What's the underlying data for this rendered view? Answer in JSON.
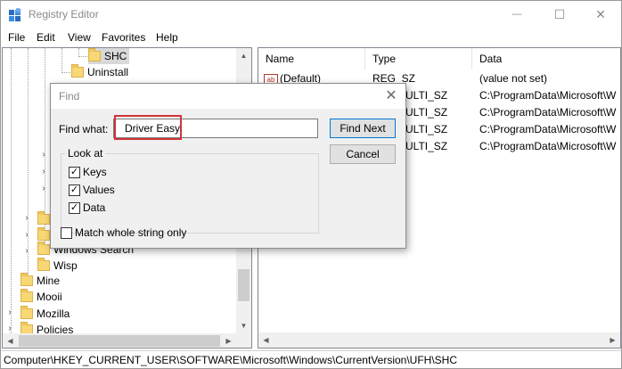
{
  "window": {
    "title": "Registry Editor",
    "minimize_glyph": "—",
    "maximize_glyph": "☐",
    "close_glyph": "✕"
  },
  "menu": [
    "File",
    "Edit",
    "View",
    "Favorites",
    "Help"
  ],
  "tree": {
    "top_items": [
      {
        "label": "SHC"
      },
      {
        "label": "Uninstall"
      }
    ],
    "hidden_under_dialog": [
      {
        "label": "Windows Search"
      },
      {
        "label": "Wisp"
      }
    ],
    "root_items": [
      {
        "label": "Mine"
      },
      {
        "label": "Mooii"
      },
      {
        "label": "Mozilla"
      },
      {
        "label": "Policies"
      }
    ]
  },
  "list": {
    "columns": [
      "Name",
      "Type",
      "Data"
    ],
    "rows": [
      {
        "name": "(Default)",
        "type": "REG_SZ",
        "data": "(value not set)"
      },
      {
        "name": "",
        "type": "ULTI_SZ",
        "data": "C:\\ProgramData\\Microsoft\\W"
      },
      {
        "name": "",
        "type": "ULTI_SZ",
        "data": "C:\\ProgramData\\Microsoft\\W"
      },
      {
        "name": "",
        "type": "ULTI_SZ",
        "data": "C:\\ProgramData\\Microsoft\\W"
      },
      {
        "name": "",
        "type": "ULTI_SZ",
        "data": "C:\\ProgramData\\Microsoft\\W"
      }
    ]
  },
  "status": {
    "path": "Computer\\HKEY_CURRENT_USER\\SOFTWARE\\Microsoft\\Windows\\CurrentVersion\\UFH\\SHC"
  },
  "find_dialog": {
    "title": "Find",
    "find_what_label": "Find what:",
    "find_what_value": "Driver Easy",
    "find_next_label": "Find Next",
    "cancel_label": "Cancel",
    "look_at_label": "Look at",
    "keys_label": "Keys",
    "keys_checked": true,
    "values_label": "Values",
    "values_checked": true,
    "data_label": "Data",
    "data_checked": true,
    "match_whole_label": "Match whole string only",
    "match_whole_checked": false,
    "highlight_color": "#d13438"
  }
}
